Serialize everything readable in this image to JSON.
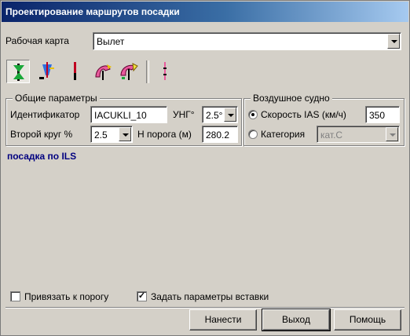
{
  "window": {
    "title": "Проектирование маршрутов посадки"
  },
  "map": {
    "label": "Рабочая карта",
    "value": "Вылет"
  },
  "toolbar": {
    "tools": [
      {
        "icon": "approach-hourglass-icon",
        "active": true
      },
      {
        "icon": "ils-localizer-icon",
        "active": false
      },
      {
        "icon": "runway-line-icon",
        "active": false
      },
      {
        "icon": "missed-approach-icon",
        "active": false
      },
      {
        "icon": "holding-turn-icon",
        "active": false
      },
      {
        "icon": "threshold-marker-icon",
        "active": false
      }
    ]
  },
  "general": {
    "title": "Общие параметры",
    "identifier_label": "Идентификатор",
    "identifier_value": "IACUKLI_10",
    "angle_label": "УНГ°",
    "angle_value": "2.5°",
    "second_circle_label": "Второй круг  %",
    "second_circle_value": "2.5",
    "threshold_height_label": "Н порога (м)",
    "threshold_height_value": "280.2"
  },
  "aircraft": {
    "title": "Воздушное судно",
    "speed_label": "Скорость IAS (км/ч)",
    "speed_value": "350",
    "speed_selected": true,
    "category_label": "Категория",
    "category_value": "кат.C",
    "category_selected": false
  },
  "mode_text": "посадка по ILS",
  "options": {
    "bind_threshold_label": "Привязать к порогу",
    "bind_threshold_checked": false,
    "insert_params_label": "Задать параметры вставки",
    "insert_params_checked": true
  },
  "buttons": {
    "apply": "Нанести",
    "exit": "Выход",
    "help": "Помощь"
  }
}
